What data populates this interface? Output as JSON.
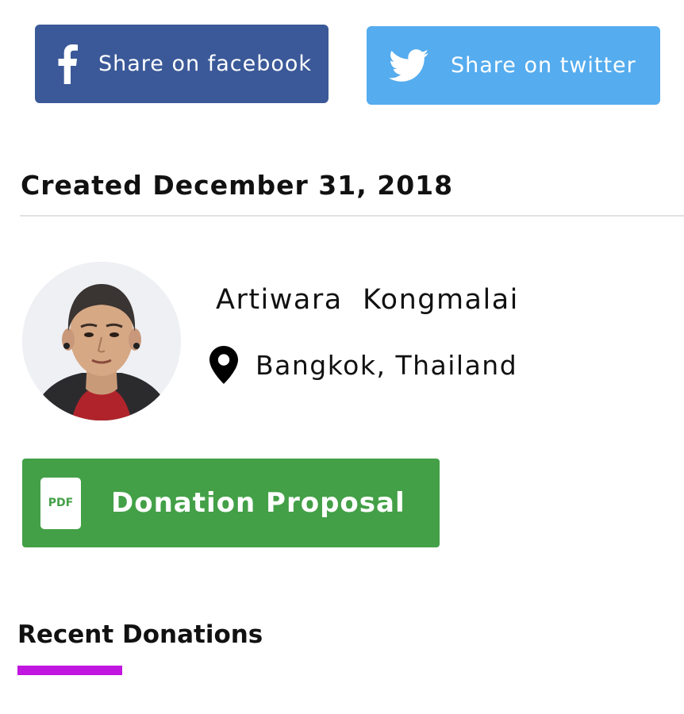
{
  "share": {
    "facebook": {
      "label": "Share on facebook",
      "icon": "facebook-icon",
      "color": "#3b5998"
    },
    "twitter": {
      "label": "Share on twitter",
      "icon": "twitter-bird-icon",
      "color": "#55acee"
    }
  },
  "created": {
    "text": "Created December 31, 2018"
  },
  "owner": {
    "name": "Artiwara  Kongmalai",
    "location": "Bangkok, Thailand",
    "location_icon": "map-pin-icon"
  },
  "proposal": {
    "icon_text": "PDF",
    "label": "Donation Proposal",
    "color": "#43a047"
  },
  "recent": {
    "title": "Recent Donations",
    "accent_color": "#c115e0"
  }
}
